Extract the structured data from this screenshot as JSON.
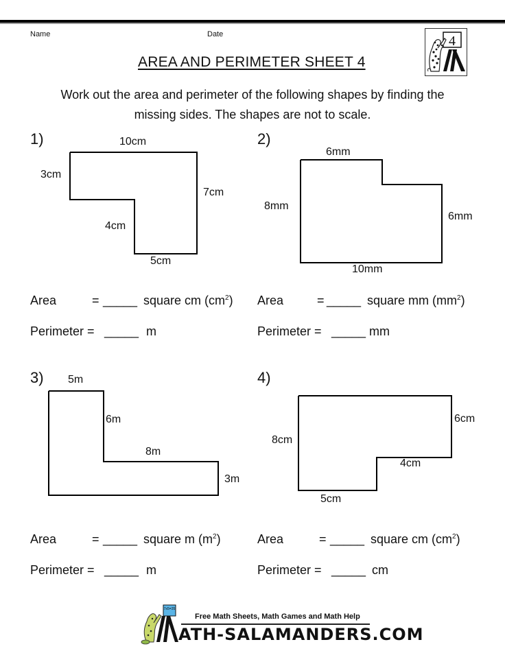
{
  "header": {
    "name_label": "Name",
    "date_label": "Date",
    "title": "AREA AND PERIMETER SHEET 4",
    "grade_badge": "4",
    "grade_icon": "salamander-easel-icon"
  },
  "instructions": {
    "line1": "Work out the area and perimeter of the following shapes by finding the",
    "line2": "missing sides. The shapes are not to scale."
  },
  "problems": [
    {
      "number": "1)",
      "labels": [
        "10cm",
        "3cm",
        "7cm",
        "4cm",
        "5cm"
      ],
      "area": {
        "label": "Area",
        "eq": "=",
        "blank": "_____",
        "unit": "square cm (cm",
        "sup": "2",
        "close": ")"
      },
      "perimeter": {
        "label": "Perimeter =",
        "blank": "_____",
        "unit": "m"
      }
    },
    {
      "number": "2)",
      "labels": [
        "6mm",
        "8mm",
        "6mm",
        "10mm"
      ],
      "area": {
        "label": "Area",
        "eq": "=",
        "blank": "_____",
        "unit": "square mm (mm",
        "sup": "2",
        "close": ")"
      },
      "perimeter": {
        "label": "Perimeter =",
        "blank": "_____",
        "unit": "mm"
      }
    },
    {
      "number": "3)",
      "labels": [
        "5m",
        "6m",
        "8m",
        "3m"
      ],
      "area": {
        "label": "Area",
        "eq": "=",
        "blank": "_____",
        "unit": "square m (m",
        "sup": "2",
        "close": ")"
      },
      "perimeter": {
        "label": "Perimeter =",
        "blank": "_____",
        "unit": "m"
      }
    },
    {
      "number": "4)",
      "labels": [
        "6cm",
        "8cm",
        "4cm",
        "5cm"
      ],
      "area": {
        "label": "Area",
        "eq": "=",
        "blank": "_____",
        "unit": "square cm (cm",
        "sup": "2",
        "close": ")"
      },
      "perimeter": {
        "label": "Perimeter =",
        "blank": "_____",
        "unit": "cm"
      }
    }
  ],
  "footer": {
    "tagline": "Free Math Sheets, Math Games and Math Help",
    "brand": "ATH-SALAMANDERS.COM",
    "board_text": "7x5=35",
    "logo_icon": "salamander-logo-icon"
  }
}
